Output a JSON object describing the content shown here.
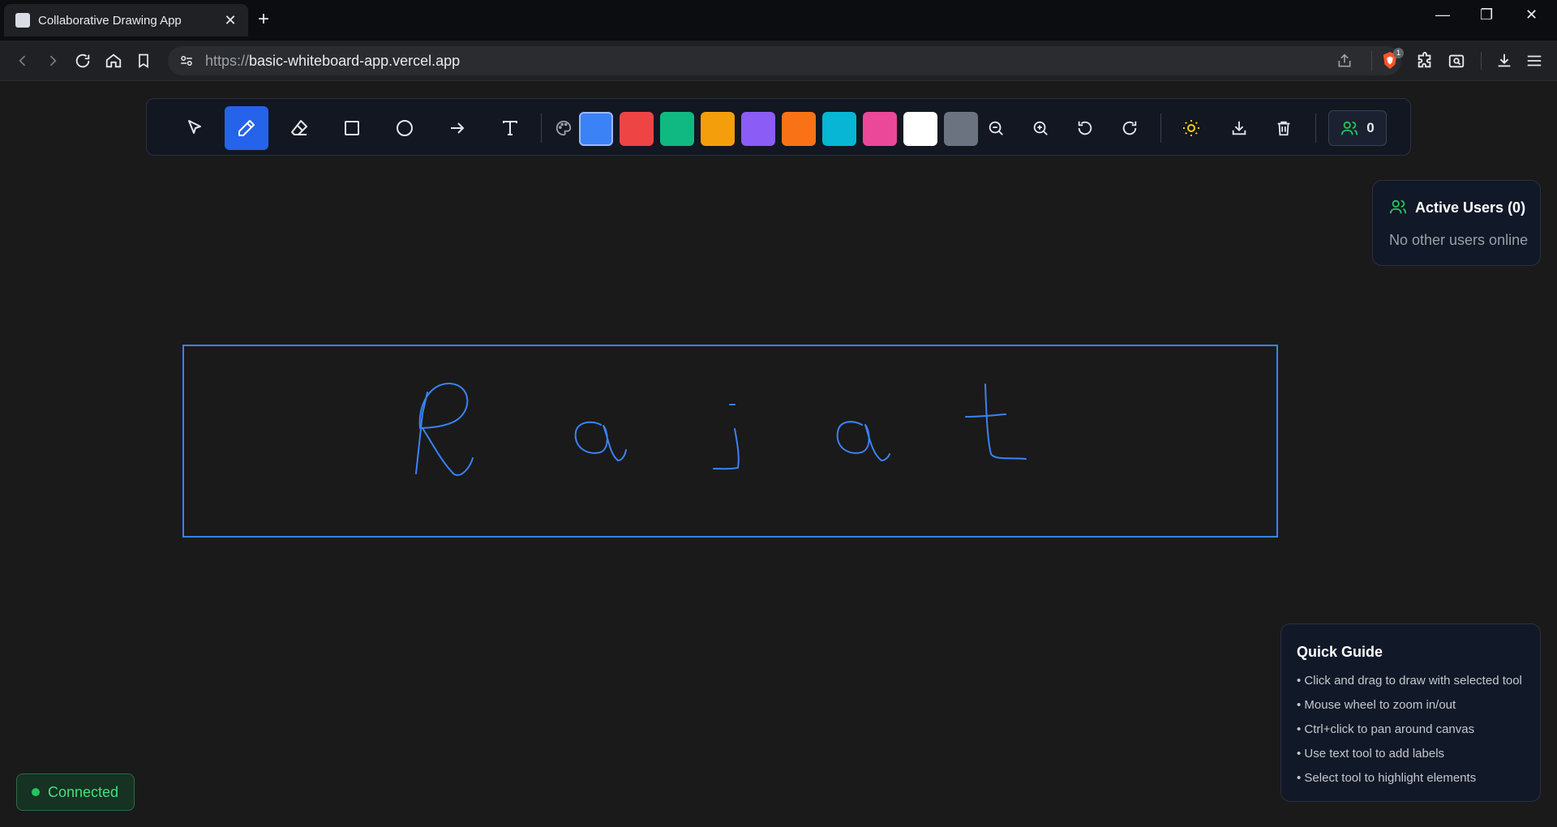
{
  "browser": {
    "tab_title": "Collaborative Drawing App",
    "url_protocol": "https://",
    "url_host": "basic-whiteboard-app.vercel.app",
    "close_glyph": "✕",
    "new_tab_glyph": "+",
    "minimize_glyph": "—",
    "maximize_glyph": "❐",
    "window_close_glyph": "✕",
    "extension_badge": "1"
  },
  "toolbar": {
    "tools": [
      {
        "icon": "cursor-icon"
      },
      {
        "icon": "pencil-icon",
        "active": true
      },
      {
        "icon": "eraser-icon"
      },
      {
        "icon": "rectangle-icon"
      },
      {
        "icon": "circle-icon"
      },
      {
        "icon": "arrow-icon"
      },
      {
        "icon": "text-icon"
      }
    ],
    "palette_icon": "palette-icon",
    "colors": [
      "#3b82f6",
      "#ef4444",
      "#10b981",
      "#f59e0b",
      "#8b5cf6",
      "#f97316",
      "#06b6d4",
      "#ec4899",
      "#ffffff",
      "#6b7280"
    ],
    "selected_color": "#3b82f6",
    "actions": [
      "zoom-out-icon",
      "zoom-in-icon",
      "undo-icon",
      "redo-icon",
      "sun-icon",
      "download-icon",
      "trash-icon"
    ],
    "users_count": "0"
  },
  "active_users": {
    "title": "Active Users (0)",
    "empty_text": "No other users online"
  },
  "quick_guide": {
    "title": "Quick Guide",
    "items": [
      "• Click and drag to draw with selected tool",
      "• Mouse wheel to zoom in/out",
      "• Ctrl+click to pan around canvas",
      "• Use text tool to add labels",
      "• Select tool to highlight elements"
    ]
  },
  "status": {
    "label": "Connected"
  },
  "colors": {
    "stroke": "#3b82f6",
    "accent": "#2563eb",
    "success": "#22c55e",
    "sun": "#facc15"
  }
}
